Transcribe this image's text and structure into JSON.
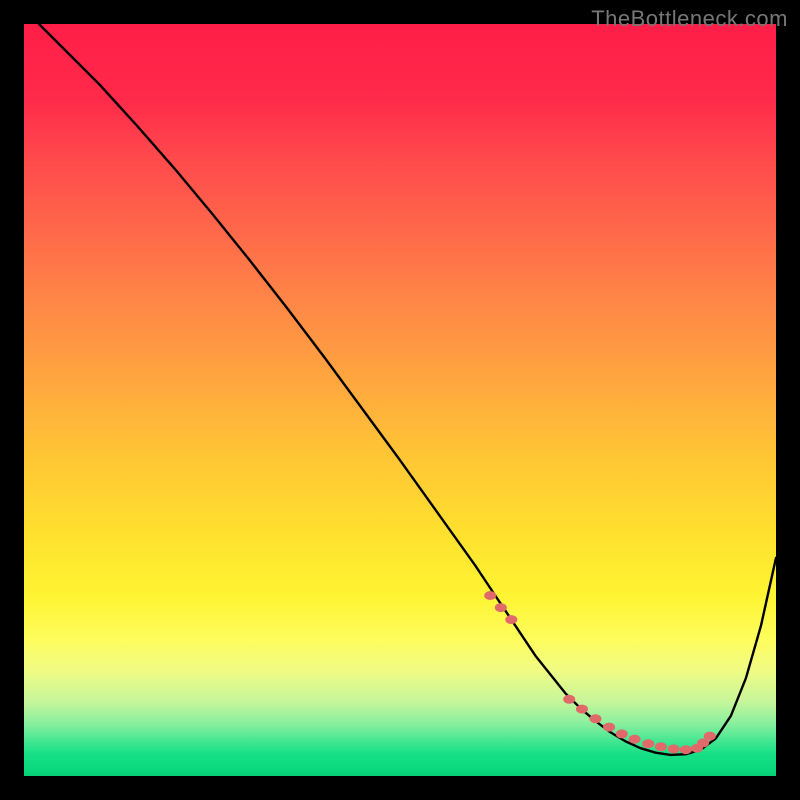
{
  "watermark": "TheBottleneck.com",
  "chart_data": {
    "type": "line",
    "title": "",
    "xlabel": "",
    "ylabel": "",
    "xlim": [
      0,
      100
    ],
    "ylim": [
      0,
      100
    ],
    "grid": false,
    "legend": false,
    "series": [
      {
        "name": "curve",
        "color": "#000000",
        "x": [
          2,
          5,
          10,
          15,
          20,
          25,
          30,
          35,
          40,
          45,
          50,
          55,
          60,
          62,
          64,
          66,
          68,
          70,
          72,
          74,
          76,
          78,
          80,
          82,
          84,
          86,
          88,
          90,
          92,
          94,
          96,
          98,
          100
        ],
        "y": [
          100,
          97,
          92,
          86.5,
          80.8,
          74.8,
          68.6,
          62.2,
          55.6,
          48.8,
          42,
          35,
          28,
          25,
          22,
          19,
          16,
          13.5,
          11,
          9,
          7.3,
          5.8,
          4.6,
          3.7,
          3.1,
          2.8,
          2.9,
          3.5,
          5,
          8,
          13,
          20,
          29
        ]
      }
    ],
    "markers": [
      {
        "name": "dotted-segment",
        "shape": "dot",
        "color": "#e06a6a",
        "x": [
          62,
          63.4,
          64.8,
          72.5,
          74.2,
          76,
          77.8,
          79.5,
          81.2,
          83,
          84.7,
          86.4,
          88,
          89.5,
          90.3,
          91.2
        ],
        "y": [
          24,
          22.4,
          20.8,
          10.2,
          8.9,
          7.6,
          6.5,
          5.6,
          4.9,
          4.3,
          3.9,
          3.6,
          3.5,
          3.7,
          4.4,
          5.3
        ]
      }
    ],
    "gradient_background": {
      "direction": "vertical",
      "stops": [
        {
          "pos": 0,
          "color": "#ff1e48"
        },
        {
          "pos": 50,
          "color": "#ffb83a"
        },
        {
          "pos": 78,
          "color": "#fff638"
        },
        {
          "pos": 100,
          "color": "#08d076"
        }
      ]
    }
  }
}
